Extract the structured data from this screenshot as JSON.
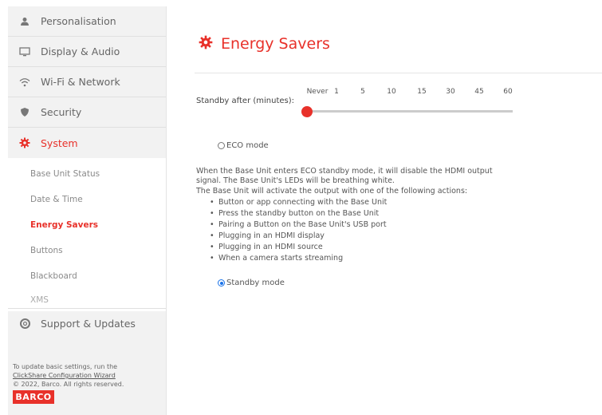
{
  "sidebar": {
    "items": [
      {
        "label": "Personalisation",
        "icon": "person-icon"
      },
      {
        "label": "Display & Audio",
        "icon": "monitor-icon"
      },
      {
        "label": "Wi-Fi & Network",
        "icon": "wifi-icon"
      },
      {
        "label": "Security",
        "icon": "shield-icon"
      },
      {
        "label": "System",
        "icon": "gear-icon"
      },
      {
        "label": "Support & Updates",
        "icon": "support-icon"
      }
    ],
    "sub_items": [
      "Base Unit Status",
      "Date & Time",
      "Energy Savers",
      "Buttons",
      "Blackboard",
      "XMS"
    ],
    "footer": {
      "line1": "To update basic settings, run the",
      "link": "ClickShare Configuration Wizard",
      "line3": "© 2022, Barco. All rights reserved.",
      "logo": "BARCO"
    }
  },
  "main": {
    "title": "Energy Savers",
    "slider": {
      "label": "Standby after (minutes):",
      "ticks": [
        "Never",
        "1",
        "5",
        "10",
        "15",
        "30",
        "45",
        "60"
      ],
      "selected": "Never"
    },
    "eco_label": "ECO mode",
    "desc_lines": [
      "When the Base Unit enters ECO standby mode, it will disable the HDMI output",
      "signal. The Base Unit's LEDs will be breathing white.",
      "The Base Unit will activate the output with one of the following actions:"
    ],
    "bullets": [
      "Button or app connecting with the Base Unit",
      "Press the standby button on the Base Unit",
      "Pairing a Button on the Base Unit's USB port",
      "Plugging in an HDMI display",
      "Plugging in an HDMI source",
      "When a camera starts streaming"
    ],
    "standby_label": "Standby mode",
    "selected_mode": "Standby mode"
  },
  "colors": {
    "accent": "#e8312a",
    "radio": "#1a73e8"
  }
}
